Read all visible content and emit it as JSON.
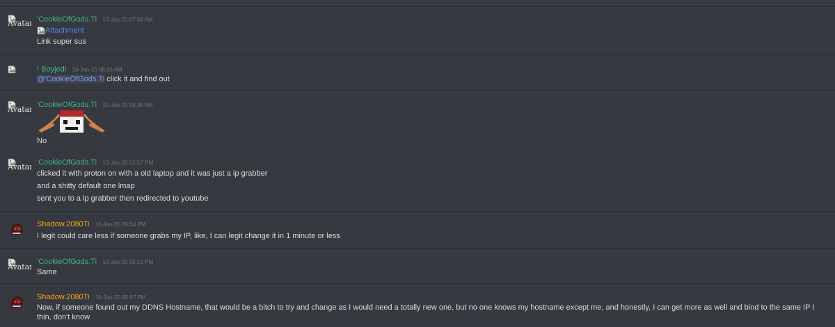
{
  "messages": [
    {
      "avatar": {
        "type": "broken",
        "alt": "Avatar"
      },
      "username": "'CookieOfGods.Ti",
      "username_color": "#43b581",
      "timestamp": "10-Jan-20 07:58 AM",
      "attachment_alt": "Attachment",
      "lines": [
        "Link super sus"
      ]
    },
    {
      "avatar": {
        "type": "broken",
        "alt": ""
      },
      "username": "! Boyjedi",
      "username_color": "#43b581",
      "timestamp": "10-Jan-20 08:36 AM",
      "mention": "@'CookieOfGods.Ti",
      "mention_tail": " click it and find out"
    },
    {
      "avatar": {
        "type": "broken",
        "alt": "Avatar"
      },
      "username": "'CookieOfGods.Ti",
      "username_color": "#43b581",
      "timestamp": "10-Jan-20 08:36 AM",
      "emoji": "custom-emoji-pointing-hands",
      "lines": [
        "No"
      ]
    },
    {
      "avatar": {
        "type": "broken",
        "alt": "Avatar"
      },
      "username": "'CookieOfGods.Ti",
      "username_color": "#43b581",
      "timestamp": "10-Jan-20 02:57 PM",
      "lines": [
        "clicked it with proton on with a old laptop and it was just a ip grabber",
        "and a shitty default one lmap",
        "sent you to a ip grabber then redirected to youtube"
      ]
    },
    {
      "avatar": {
        "type": "image"
      },
      "username": "Shadow.2080Ti",
      "username_color": "#faa61a",
      "timestamp": "10-Jan-20 05:04 PM",
      "lines": [
        "I legit could care less if someone grabs my IP, like, I can legit change it in 1 minute or less"
      ]
    },
    {
      "avatar": {
        "type": "broken",
        "alt": "Avatar"
      },
      "username": "'CookieOfGods.Ti",
      "username_color": "#43b581",
      "timestamp": "10-Jan-20 05:10 PM",
      "lines": [
        "Same"
      ]
    },
    {
      "avatar": {
        "type": "image"
      },
      "username": "Shadow.2080Ti",
      "username_color": "#faa61a",
      "timestamp": "10-Jan-20 05:57 PM",
      "lines": [
        "Now, if someone found out my DDNS Hostname, that would be a bitch to try and change as I would need a totally new one, but no one knows my hostname except me, and honestly, I can get more as well and bind to the same IP I thin, don't know"
      ]
    }
  ]
}
